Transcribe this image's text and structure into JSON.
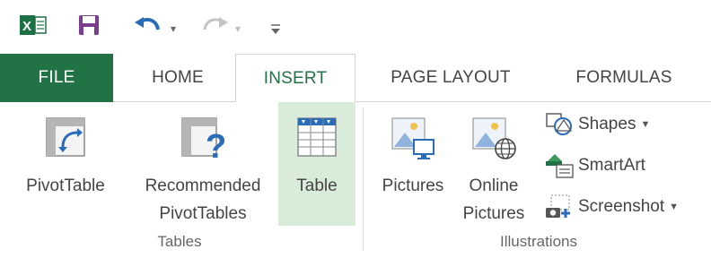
{
  "quick_access": {
    "excel_icon": "excel-logo-icon",
    "save_icon": "save-icon",
    "undo_icon": "undo-icon",
    "redo_icon": "redo-icon",
    "customize_icon": "customize-toolbar-icon"
  },
  "tabs": [
    {
      "label": "FILE"
    },
    {
      "label": "HOME"
    },
    {
      "label": "INSERT"
    },
    {
      "label": "PAGE LAYOUT"
    },
    {
      "label": "FORMULAS"
    }
  ],
  "active_tab": "INSERT",
  "ribbon": {
    "tables_group": {
      "label": "Tables",
      "pivot_table": {
        "label": "PivotTable",
        "icon": "pivottable-icon"
      },
      "recommended": {
        "label_line1": "Recommended",
        "label_line2": "PivotTables",
        "icon": "recommended-pivottables-icon"
      },
      "table": {
        "label": "Table",
        "icon": "table-icon"
      }
    },
    "illustrations_group": {
      "label": "Illustrations",
      "pictures": {
        "label": "Pictures",
        "icon": "pictures-icon"
      },
      "online_pictures": {
        "label_line1": "Online",
        "label_line2": "Pictures",
        "icon": "online-pictures-icon"
      },
      "shapes": {
        "label": "Shapes",
        "icon": "shapes-icon"
      },
      "smartart": {
        "label": "SmartArt",
        "icon": "smartart-icon"
      },
      "screenshot": {
        "label": "Screenshot",
        "icon": "screenshot-icon"
      }
    }
  },
  "colors": {
    "file_tab_bg": "#217346",
    "active_tab_text": "#217346",
    "selected_button_bg": "#d9ecd9"
  }
}
